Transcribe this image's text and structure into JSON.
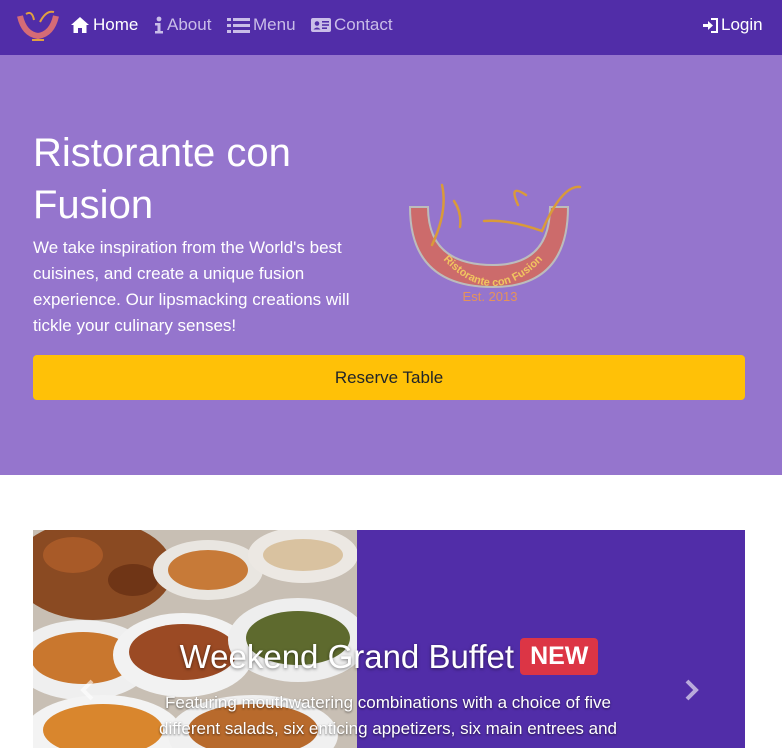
{
  "navbar": {
    "items": [
      {
        "label": "Home",
        "icon": "home-icon",
        "active": true
      },
      {
        "label": "About",
        "icon": "info-icon",
        "active": false
      },
      {
        "label": "Menu",
        "icon": "list-icon",
        "active": false
      },
      {
        "label": "Contact",
        "icon": "address-card-icon",
        "active": false
      }
    ],
    "login": {
      "label": "Login",
      "icon": "sign-in-icon"
    }
  },
  "hero": {
    "title": "Ristorante con Fusion",
    "tagline": "We take inspiration from the World's best cuisines, and create a unique fusion experience. Our lipsmacking creations will tickle your culinary senses!",
    "reserve_label": "Reserve Table",
    "logo": {
      "text": "Ristorante con Fusion",
      "est": "Est. 2013"
    }
  },
  "carousel": {
    "title": "Weekend Grand Buffet",
    "badge": "NEW",
    "text": "Featuring mouthwatering combinations with a choice of five different salads, six enticing appetizers, six main entrees and"
  },
  "colors": {
    "primary": "#512DA8",
    "hero_bg": "#9575CD",
    "accent": "#FFC107",
    "badge": "#dc3545"
  }
}
